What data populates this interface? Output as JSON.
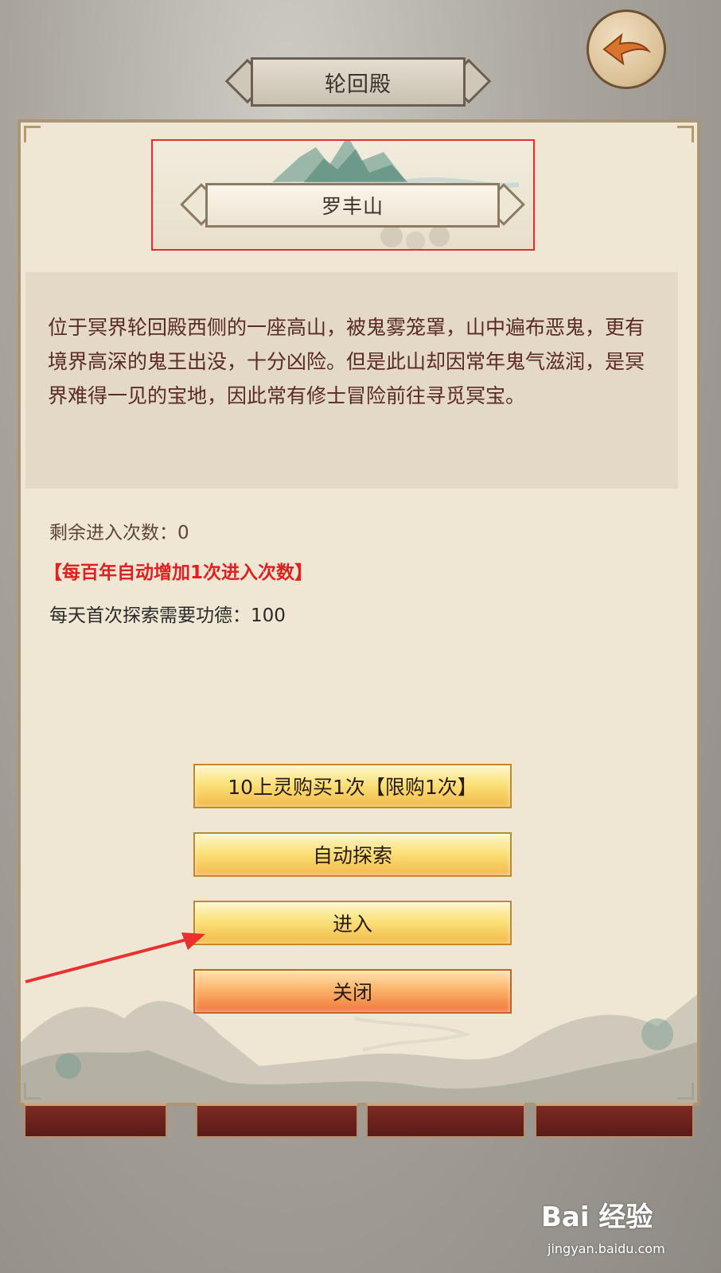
{
  "header": {
    "title": "轮回殿"
  },
  "location": {
    "name": "罗丰山",
    "description": "位于冥界轮回殿西侧的一座高山，被鬼雾笼罩，山中遍布恶鬼，更有境界高深的鬼王出没，十分凶险。但是此山却因常年鬼气滋润，是冥界难得一见的宝地，因此常有修士冒险前往寻觅冥宝。"
  },
  "info": {
    "remaining_entries": "剩余进入次数：0",
    "auto_add_notice": "【每百年自动增加1次进入次数】",
    "daily_cost": "每天首次探索需要功德：100"
  },
  "buttons": {
    "buy": "10上灵购买1次【限购1次】",
    "auto_explore": "自动探索",
    "enter": "进入",
    "close": "关闭"
  },
  "watermark": {
    "brand": "Bai 经验",
    "url": "jingyan.baidu.com"
  },
  "colors": {
    "highlight_box": "#e82b2b",
    "notice_red": "#e02121",
    "annotation_arrow": "#e8312f"
  }
}
